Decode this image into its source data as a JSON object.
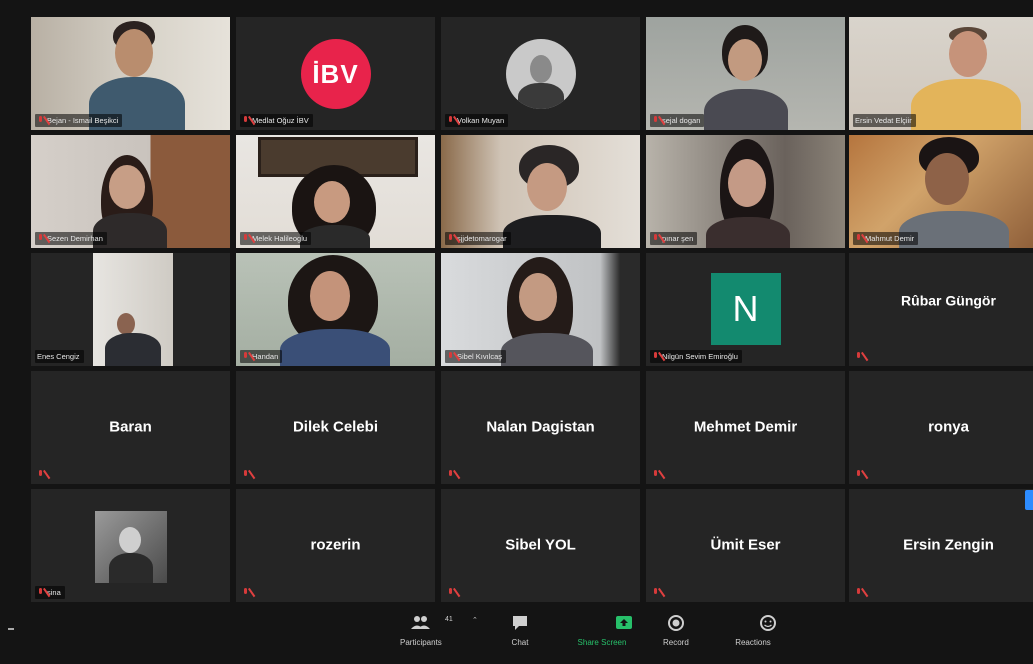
{
  "tiles": [
    {
      "name": "Bejan - Ismail Beşikci"
    },
    {
      "name": "Medlat Oğuz İBV",
      "logo_text": "İBV"
    },
    {
      "name": "Volkan Muyan"
    },
    {
      "name": "sejal dogan"
    },
    {
      "name": "Ersin Vedat Elçiir"
    },
    {
      "name": "Sezen Demirhan"
    },
    {
      "name": "Melek Halileoglu"
    },
    {
      "name": "sjjdetomarogar"
    },
    {
      "name": "pınar şen"
    },
    {
      "name": "Mahmut Demir"
    },
    {
      "name": "Enes Cengiz"
    },
    {
      "name": "Handan"
    },
    {
      "name": "Sibel Kıvılcaş"
    },
    {
      "name": "Nilgün Sevim Emiroğlu",
      "initial": "N"
    },
    {
      "name": "Rûbar Güngör"
    },
    {
      "name": "Baran"
    },
    {
      "name": "Dilek Celebi"
    },
    {
      "name": "Nalan Dagistan"
    },
    {
      "name": "Mehmet Demir"
    },
    {
      "name": "ronya"
    },
    {
      "name": "sina"
    },
    {
      "name": "rozerin"
    },
    {
      "name": "Sibel YOL"
    },
    {
      "name": "Ümit Eser"
    },
    {
      "name": "Ersin Zengin"
    }
  ],
  "toolbar": {
    "participants_label": "Participants",
    "participants_count": "41",
    "chat_label": "Chat",
    "share_label": "Share Screen",
    "record_label": "Record",
    "reactions_label": "Reactions"
  },
  "colors": {
    "background": "#141414",
    "tile": "#252525",
    "active_border": "#c7e23a",
    "share_green": "#27c06a",
    "muted_red": "#d63a3a",
    "ibv_pink": "#e8234b",
    "initial_teal": "#138a6f"
  },
  "icons": {
    "mic_muted": "mic-muted-icon",
    "participants": "participants-icon",
    "chat": "chat-icon",
    "share": "share-screen-icon",
    "record": "record-icon",
    "reactions": "reactions-icon"
  }
}
